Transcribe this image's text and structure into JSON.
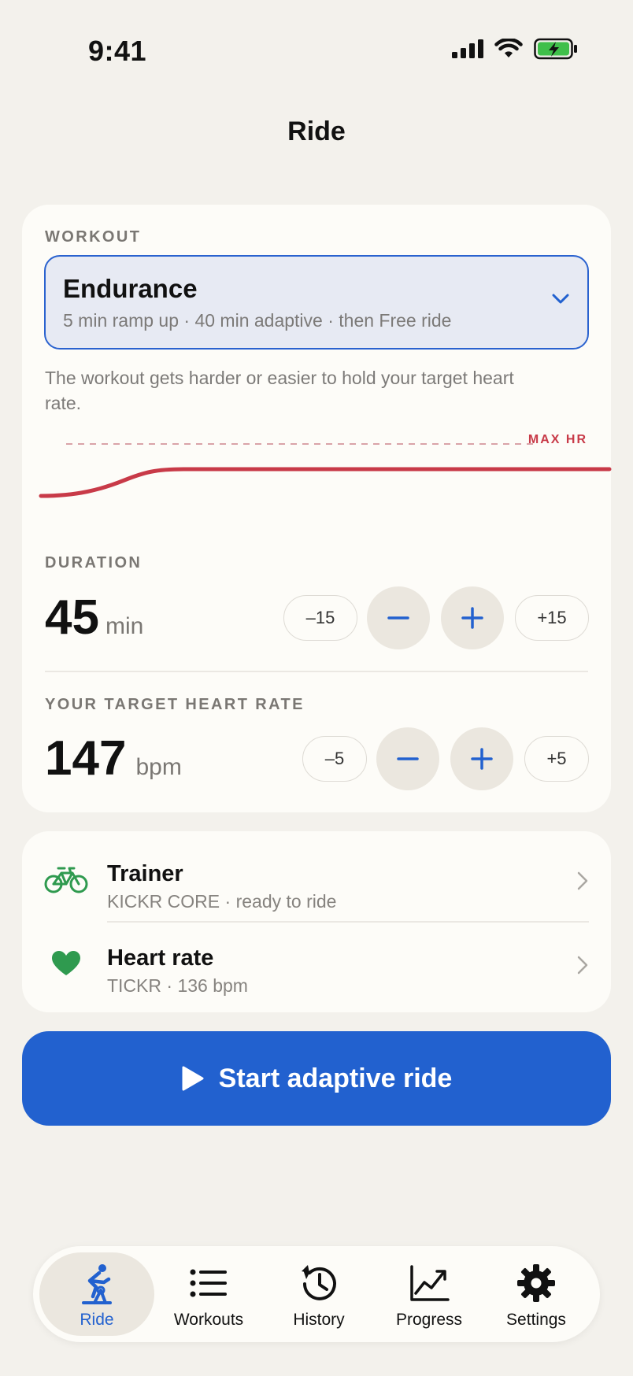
{
  "status": {
    "time": "9:41"
  },
  "page": {
    "title": "Ride"
  },
  "workout": {
    "section_label": "WORKOUT",
    "name": "Endurance",
    "description": "5 min ramp up · 40 min adaptive · then Free ride",
    "explanation": "The workout gets harder or easier to hold your target heart rate.",
    "max_hr_label": "MAX HR"
  },
  "duration": {
    "section_label": "DURATION",
    "value": "45",
    "unit": "min",
    "minus_big": "–15",
    "plus_big": "+15"
  },
  "heart_rate_target": {
    "section_label": "YOUR TARGET HEART RATE",
    "value": "147",
    "unit": "bpm",
    "minus_big": "–5",
    "plus_big": "+5"
  },
  "devices": [
    {
      "title": "Trainer",
      "subtitle": "KICKR CORE · ready to ride",
      "icon": "bicycle-icon"
    },
    {
      "title": "Heart rate",
      "subtitle": "TICKR · 136 bpm",
      "icon": "heart-icon"
    }
  ],
  "start_button": {
    "label": "Start adaptive ride"
  },
  "tabs": [
    {
      "label": "Ride",
      "icon": "cyclist-icon",
      "active": true
    },
    {
      "label": "Workouts",
      "icon": "list-icon",
      "active": false
    },
    {
      "label": "History",
      "icon": "history-icon",
      "active": false
    },
    {
      "label": "Progress",
      "icon": "chart-icon",
      "active": false
    },
    {
      "label": "Settings",
      "icon": "gear-icon",
      "active": false
    }
  ],
  "colors": {
    "accent": "#2261cf",
    "max_hr": "#c83a48",
    "device_green": "#2f9a4f",
    "background": "#f3f1ec",
    "card": "#fdfcf8"
  }
}
